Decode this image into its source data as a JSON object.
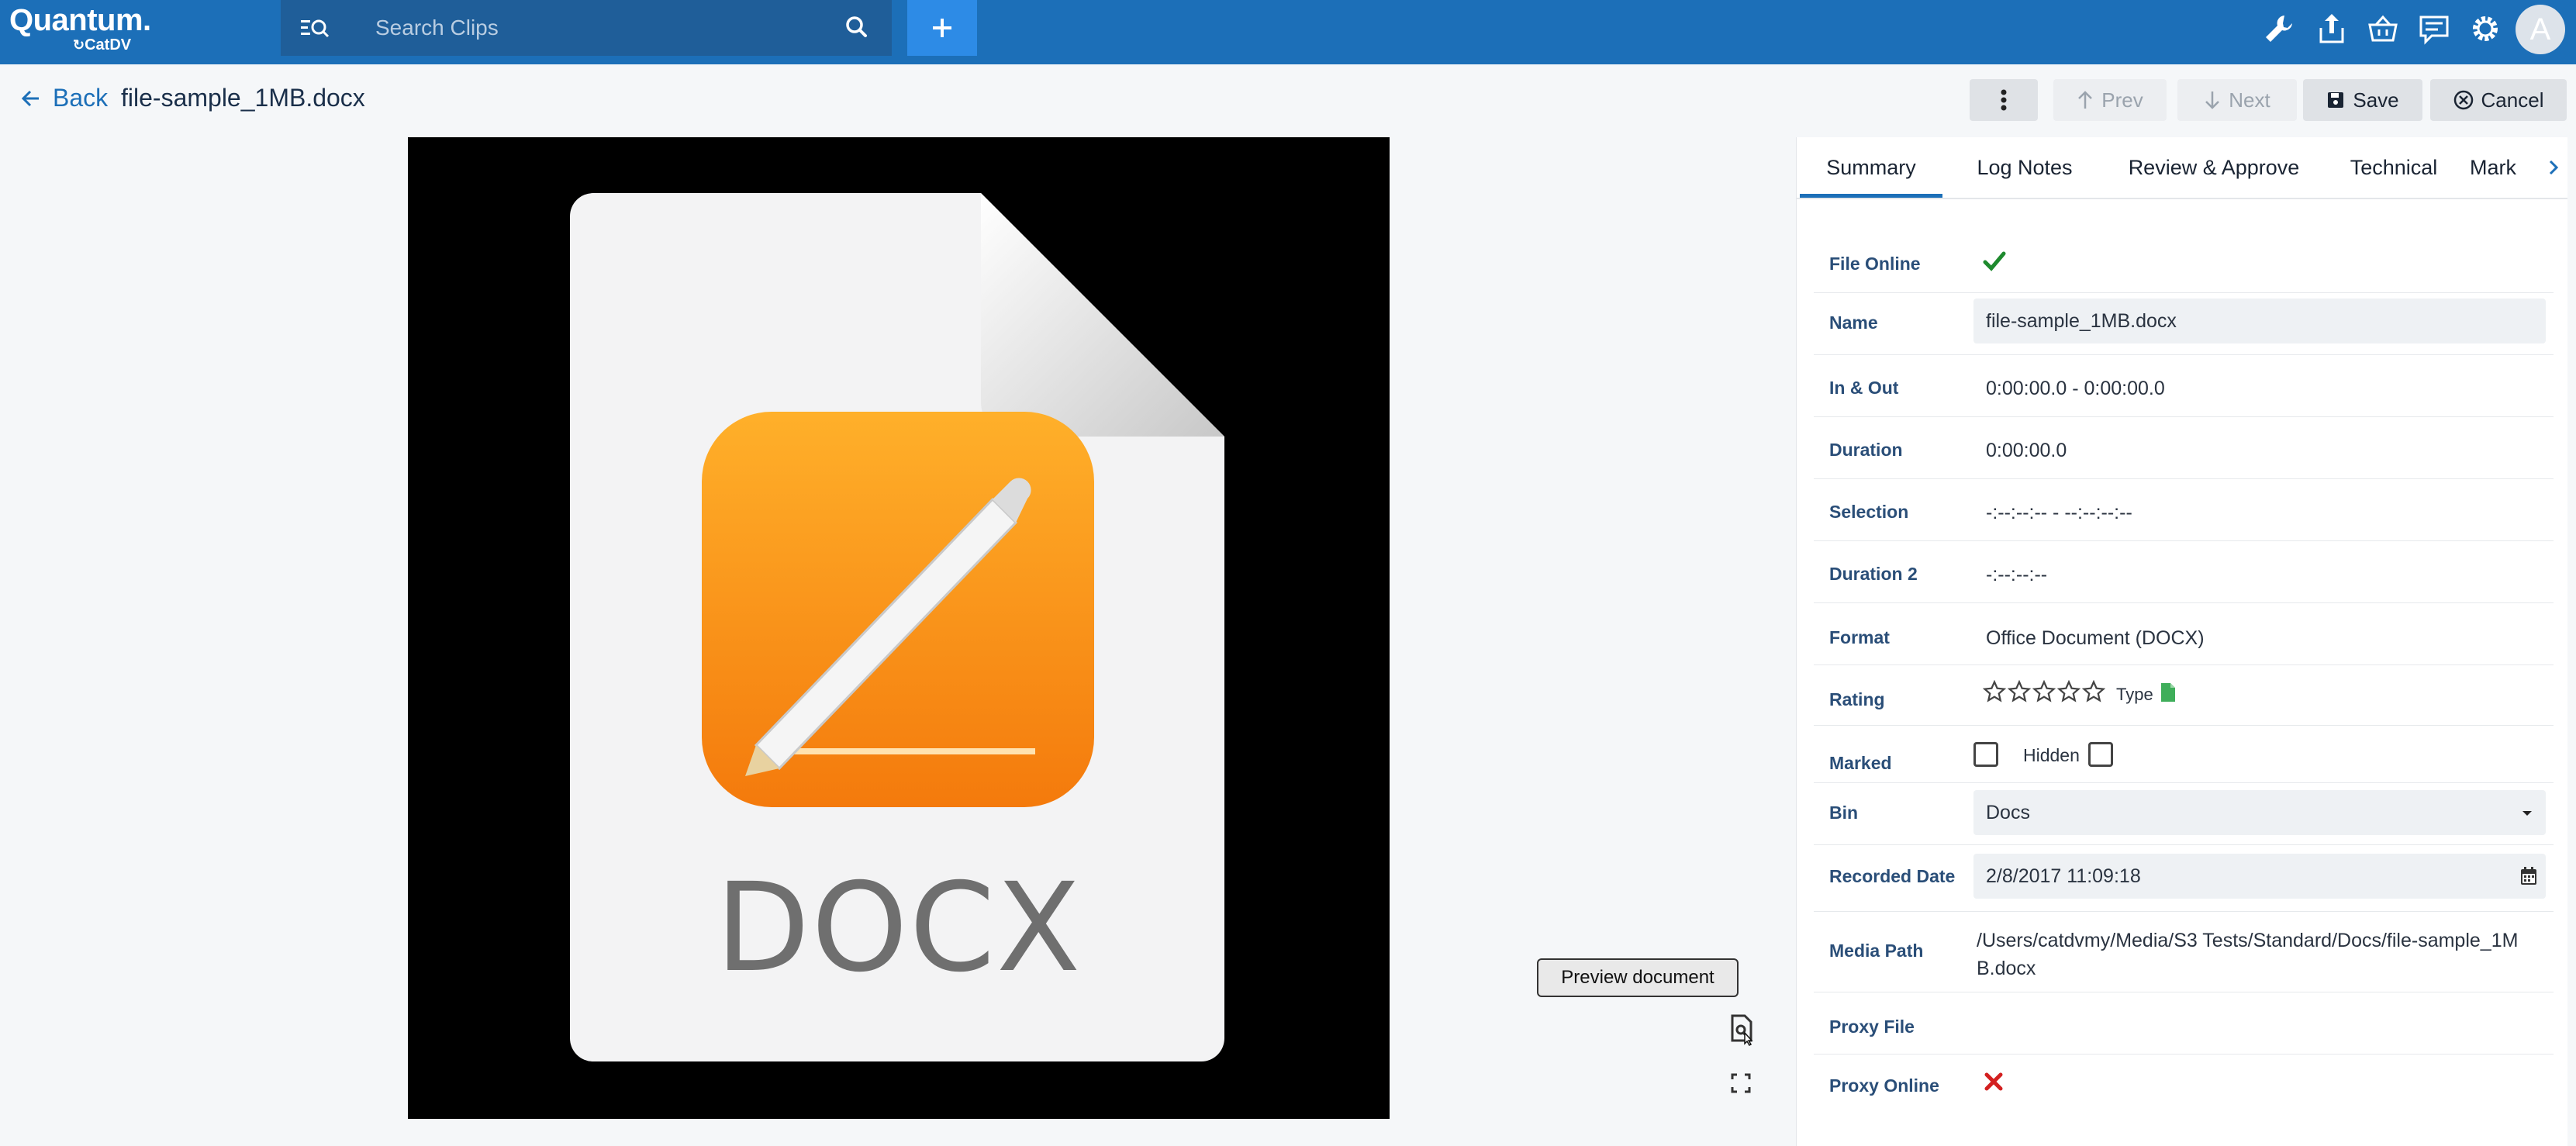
{
  "brand": {
    "name": "Quantum.",
    "product": "CatDV"
  },
  "search": {
    "placeholder": "Search Clips"
  },
  "user": {
    "initial": "A"
  },
  "header": {
    "back_label": "Back",
    "file_title": "file-sample_1MB.docx",
    "prev_label": "Prev",
    "next_label": "Next",
    "save_label": "Save",
    "cancel_label": "Cancel"
  },
  "preview": {
    "file_type_label": "DOCX",
    "tooltip": "Preview document"
  },
  "tabs": [
    {
      "label": "Summary",
      "active": true
    },
    {
      "label": "Log Notes"
    },
    {
      "label": "Review & Approve"
    },
    {
      "label": "Technical"
    },
    {
      "label": "Mark"
    }
  ],
  "fields": {
    "file_online": {
      "label": "File Online",
      "value": true
    },
    "name": {
      "label": "Name",
      "value": "file-sample_1MB.docx"
    },
    "in_out": {
      "label": "In & Out",
      "value": "0:00:00.0 - 0:00:00.0"
    },
    "duration": {
      "label": "Duration",
      "value": "0:00:00.0"
    },
    "selection": {
      "label": "Selection",
      "value": "-:--:--:-- - --:--:--:--"
    },
    "duration2": {
      "label": "Duration 2",
      "value": "-:--:--:--"
    },
    "format": {
      "label": "Format",
      "value": "Office Document (DOCX)"
    },
    "rating": {
      "label": "Rating",
      "stars": 0,
      "max_stars": 5,
      "type_label": "Type"
    },
    "marked": {
      "label": "Marked",
      "checked": false,
      "hidden_label": "Hidden",
      "hidden_checked": false
    },
    "bin": {
      "label": "Bin",
      "value": "Docs"
    },
    "recorded_date": {
      "label": "Recorded Date",
      "value": "2/8/2017 11:09:18"
    },
    "media_path": {
      "label": "Media Path",
      "value_line1": "/Users/catdvmy/Media/S3 Tests/Standard/Docs/file-sample_1M",
      "value_line2": "B.docx"
    },
    "proxy_file": {
      "label": "Proxy File",
      "value": ""
    },
    "proxy_online": {
      "label": "Proxy Online",
      "value": false
    }
  },
  "colors": {
    "topbar": "#1c6fb8",
    "accent": "#1c6fb8",
    "add_button": "#2d8be6",
    "online_check": "#1e8a2e",
    "offline_x": "#d32020",
    "type_icon": "#3fae5a"
  }
}
